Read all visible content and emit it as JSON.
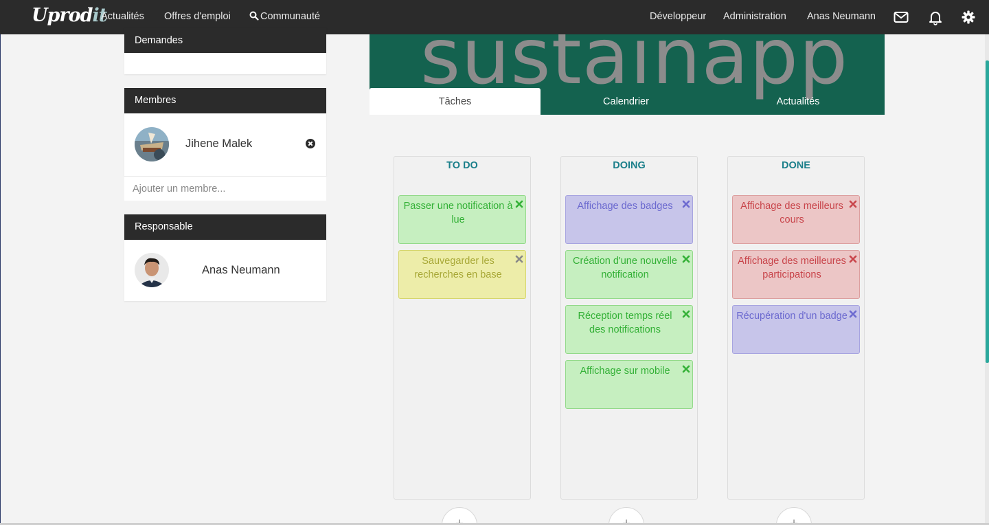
{
  "navbar": {
    "logo_main": "Uprod",
    "logo_accent": "it",
    "links": [
      "Actualités",
      "Offres d'emploi",
      "Communauté"
    ],
    "right_links": [
      "Développeur",
      "Administration",
      "Anas Neumann"
    ]
  },
  "sidebar": {
    "demandes_title": "Demandes",
    "membres_title": "Membres",
    "member_name": "Jihene Malek",
    "add_member_placeholder": "Ajouter un membre...",
    "responsable_title": "Responsable",
    "responsable_name": "Anas Neumann"
  },
  "project": {
    "banner_text": "sustainapp",
    "tabs": [
      "Tâches",
      "Calendrier",
      "Actualités"
    ],
    "active_tab": "Tâches"
  },
  "board": {
    "columns": [
      {
        "title": "TO DO",
        "cards": [
          {
            "text": "Passer une notification à lue",
            "color": "green"
          },
          {
            "text": "Sauvegarder les recherches en base",
            "color": "yellow"
          }
        ]
      },
      {
        "title": "DOING",
        "cards": [
          {
            "text": "Affichage des badges",
            "color": "purple"
          },
          {
            "text": "Création d'une nouvelle notification",
            "color": "green"
          },
          {
            "text": "Réception temps réel des notifications",
            "color": "green"
          },
          {
            "text": "Affichage sur mobile",
            "color": "green"
          }
        ]
      },
      {
        "title": "DONE",
        "cards": [
          {
            "text": "Affichage des meilleurs cours",
            "color": "red"
          },
          {
            "text": "Affichage des meilleures participations",
            "color": "red"
          },
          {
            "text": "Récupération d'un badge",
            "color": "purple"
          }
        ]
      }
    ],
    "add_label": "+"
  },
  "colors": {
    "navbar_bg": "#2b2b2b",
    "banner_bg": "#14624f",
    "column_title": "#1a7f8a",
    "card_green": "#c6efc0",
    "card_yellow": "#ededa9",
    "card_purple": "#c7c5ea",
    "card_red": "#ecc6c6"
  }
}
